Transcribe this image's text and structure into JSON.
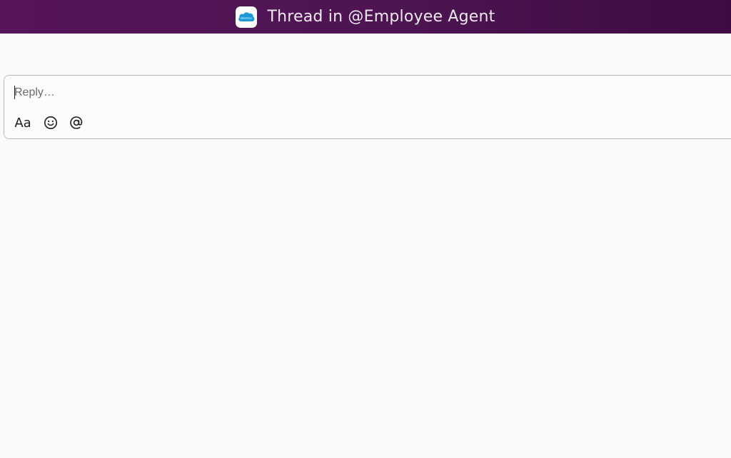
{
  "header": {
    "title": "Thread in @Employee Agent",
    "logo_icon": "salesforce-cloud-icon",
    "logo_text": "salesforce",
    "background": "#4e1552"
  },
  "composer": {
    "placeholder": "Reply…",
    "value": "",
    "toolbar": {
      "format_label": "Aa",
      "emoji_icon": "emoji-smile-icon",
      "mention_icon": "at-mention-icon"
    }
  }
}
